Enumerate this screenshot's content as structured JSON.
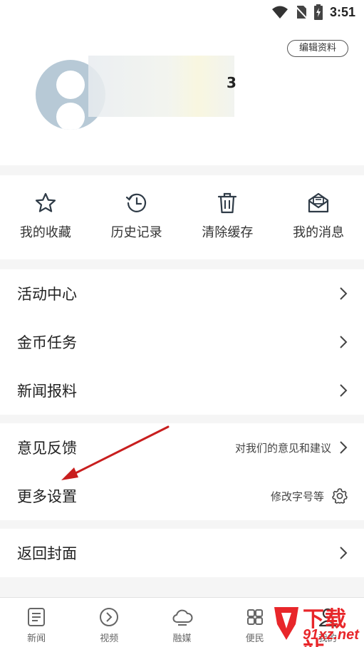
{
  "status_bar": {
    "time": "3:51",
    "icons": [
      "wifi-icon",
      "no-sim-icon",
      "battery-charging-icon"
    ]
  },
  "profile": {
    "edit_label": "编辑资料",
    "name_visible_fragment": "3",
    "avatar_icon": "default-avatar-icon"
  },
  "quick_actions": [
    {
      "label": "我的收藏",
      "icon": "star-icon"
    },
    {
      "label": "历史记录",
      "icon": "history-icon"
    },
    {
      "label": "清除缓存",
      "icon": "trash-icon"
    },
    {
      "label": "我的消息",
      "icon": "mail-icon"
    }
  ],
  "menu_group1": [
    {
      "label": "活动中心"
    },
    {
      "label": "金币任务"
    },
    {
      "label": "新闻报料"
    }
  ],
  "menu_group2": [
    {
      "label": "意见反馈",
      "hint": "对我们的意见和建议"
    },
    {
      "label": "更多设置",
      "hint": "修改字号等"
    }
  ],
  "menu_group3": [
    {
      "label": "返回封面"
    }
  ],
  "tabbar": [
    {
      "label": "新闻",
      "icon": "news-icon"
    },
    {
      "label": "视频",
      "icon": "play-icon"
    },
    {
      "label": "融媒",
      "icon": "cloud-icon"
    },
    {
      "label": "便民",
      "icon": "service-icon"
    },
    {
      "label": "我的",
      "icon": "user-icon"
    }
  ],
  "watermark": {
    "line1": "下载站",
    "line2": "91xz.net"
  },
  "colors": {
    "accent_red": "#e8262a",
    "icon_stroke": "#2f3b47",
    "avatar_bg": "#b7c9d6",
    "annotation_arrow": "#c81e1e"
  }
}
